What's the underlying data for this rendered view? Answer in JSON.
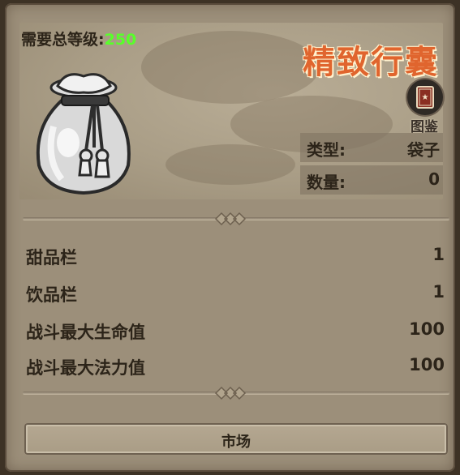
{
  "item": {
    "required_level_label": "需要总等级:",
    "required_level": "250",
    "name": "精致行囊",
    "codex_label": "图鉴",
    "icon": "cloth-bag-icon"
  },
  "info": [
    {
      "label": "类型:",
      "value": "袋子"
    },
    {
      "label": "数量:",
      "value": "0"
    }
  ],
  "attributes": [
    {
      "label": "甜品栏",
      "value": "1"
    },
    {
      "label": "饮品栏",
      "value": "1"
    },
    {
      "label": "战斗最大生命值",
      "value": "100"
    },
    {
      "label": "战斗最大法力值",
      "value": "100"
    }
  ],
  "actions": {
    "market_label": "市场"
  },
  "colors": {
    "title": "#e0652e",
    "level_value": "#58ff2a",
    "panel": "#9c8f7a"
  }
}
